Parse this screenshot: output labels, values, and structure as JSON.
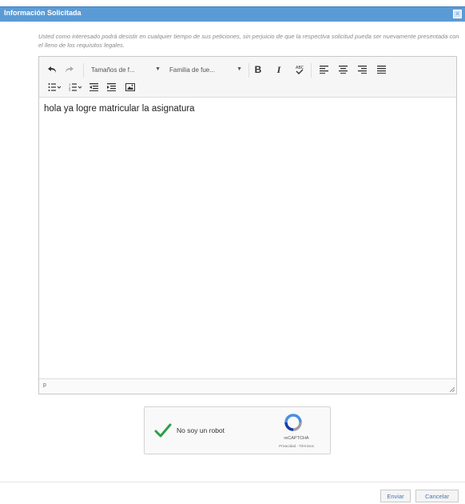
{
  "dialog": {
    "title": "Información Solicitada",
    "close_label": "×"
  },
  "notice": {
    "text": "Usted como interesado podrá desistir en cualquier tiempo de sus peticiones, sin perjuicio de que la respectiva solicitud pueda ser nuevamente presentada con el lleno de los requisitos legales."
  },
  "editor": {
    "toolbar": {
      "font_size_label": "Tamaños de f...",
      "font_family_label": "Familia de fue...",
      "bold_label": "B",
      "italic_label": "I"
    },
    "content": "hola ya logre matricular la asignatura",
    "status_path": "p"
  },
  "captcha": {
    "label": "No soy un robot",
    "brand": "reCAPTCHA",
    "terms": "Privacidad - Términos"
  },
  "buttons": {
    "submit": "Enviar",
    "cancel": "Cancelar"
  },
  "colors": {
    "titlebar": "#5b9bd5",
    "check": "#2e9e4a",
    "link_text": "#4a78b0"
  }
}
